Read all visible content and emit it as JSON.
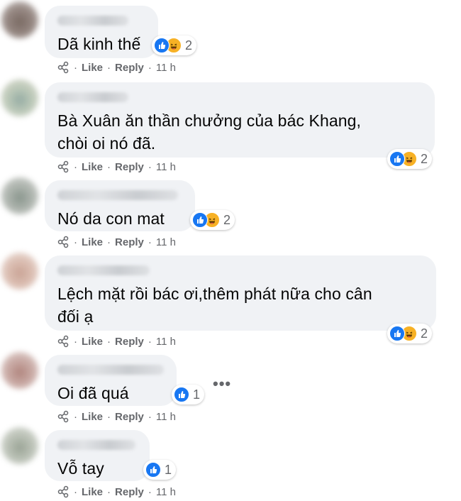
{
  "colors": {
    "bubble": "#f0f2f5",
    "text": "#050505",
    "meta": "#65676b",
    "like": "#1877f2",
    "haha": "#f7b125"
  },
  "icons": [
    "share-icon",
    "like-reaction-icon",
    "haha-reaction-icon",
    "more-options-icon"
  ],
  "comments": [
    {
      "text": "Dã kinh thế",
      "reaction_count": "2",
      "like": "Like",
      "reply": "Reply",
      "time": "11 h"
    },
    {
      "text": "Bà Xuân ăn thần chưởng của bác Khang,\nchòi oi nó đã.",
      "reaction_count": "2",
      "like": "Like",
      "reply": "Reply",
      "time": "11 h"
    },
    {
      "text": "Nó da con mat",
      "reaction_count": "2",
      "like": "Like",
      "reply": "Reply",
      "time": "11 h"
    },
    {
      "text": "Lệch mặt rồi bác ơi,thêm phát nữa cho cân\nđối ạ",
      "reaction_count": "2",
      "like": "Like",
      "reply": "Reply",
      "time": "11 h"
    },
    {
      "text": "Oi đã quá",
      "reaction_count": "1",
      "like": "Like",
      "reply": "Reply",
      "time": "11 h"
    },
    {
      "text": "Vỗ tay",
      "reaction_count": "1",
      "like": "Like",
      "reply": "Reply",
      "time": "11 h"
    }
  ],
  "more_label": "•••"
}
